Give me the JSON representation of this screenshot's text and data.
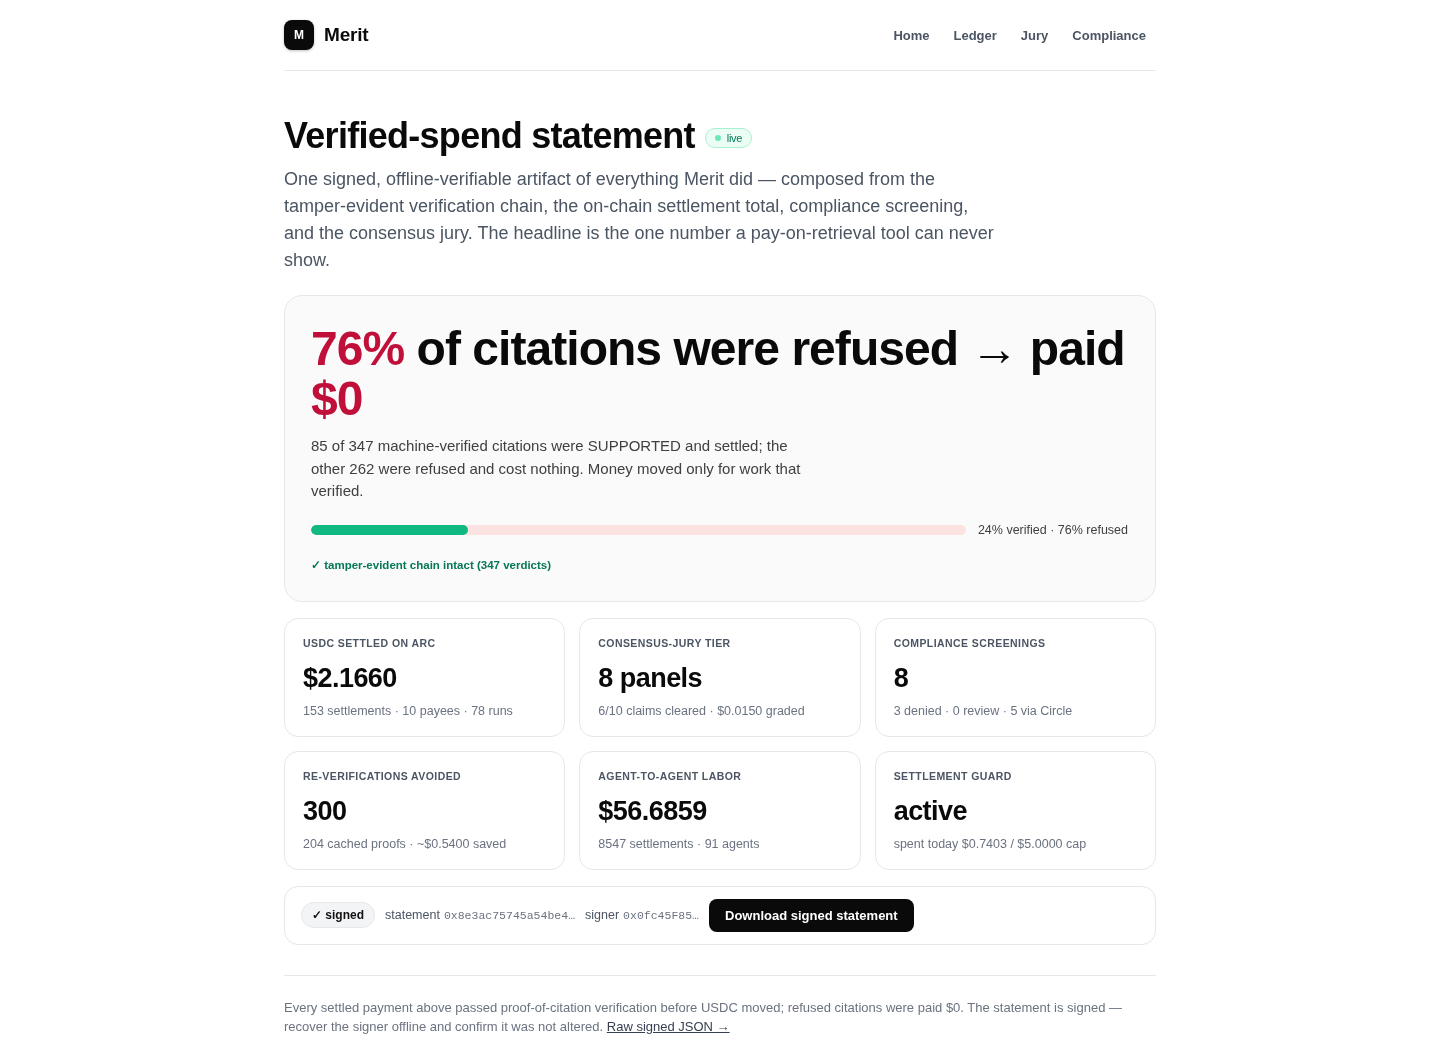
{
  "brand": {
    "mark": "M",
    "name": "Merit"
  },
  "nav": [
    "Home",
    "Ledger",
    "Jury",
    "Compliance"
  ],
  "page": {
    "title": "Verified-spend statement",
    "status_badge": "live",
    "intro": "One signed, offline-verifiable artifact of everything Merit did — composed from the tamper-evident verification chain, the on-chain settlement total, compliance screening, and the consensus jury. The headline is the one number a pay-on-retrieval tool can never show."
  },
  "hero": {
    "headline": [
      {
        "text": "76%",
        "accent": true
      },
      {
        "text": "of citations were refused → paid",
        "accent": false
      },
      {
        "text": "$0",
        "accent": true
      }
    ],
    "summary": "85 of 347 machine-verified citations were SUPPORTED and settled; the other 262 were refused and cost nothing. Money moved only for work that verified.",
    "progress": {
      "level": 0.24,
      "label": "24% verified · 76% refused"
    },
    "chain_status": "✓ tamper-evident chain intact (347 verdicts)"
  },
  "stats": [
    {
      "label": "USDC SETTLED ON ARC",
      "value": "$2.1660",
      "detail": "153 settlements · 10 payees · 78 runs"
    },
    {
      "label": "CONSENSUS-JURY TIER",
      "value": "8 panels",
      "detail": "6/10 claims cleared · $0.0150 graded"
    },
    {
      "label": "COMPLIANCE SCREENINGS",
      "value": "8",
      "detail": "3 denied · 0 review · 5 via Circle"
    },
    {
      "label": "RE-VERIFICATIONS AVOIDED",
      "value": "300",
      "detail": "204 cached proofs · ~$0.5400 saved"
    },
    {
      "label": "AGENT-TO-AGENT LABOR",
      "value": "$56.6859",
      "detail": "8547 settlements · 91 agents"
    },
    {
      "label": "SETTLEMENT GUARD",
      "value": "active",
      "detail": "spent today $0.7403 / $5.0000 cap"
    }
  ],
  "signature": {
    "badge": "✓ signed",
    "statement_label": "statement",
    "statement_hash": "0x8e3ac75745a54be4…",
    "signer_label": "signer",
    "signer_hash": "0x0fc45F85…",
    "button": "Download signed statement"
  },
  "footer": {
    "text": "Every settled payment above passed proof-of-citation verification before USDC moved; refused citations were paid $0. The statement is signed — recover the signer offline and confirm it was not altered.",
    "link": "Raw signed JSON →"
  }
}
